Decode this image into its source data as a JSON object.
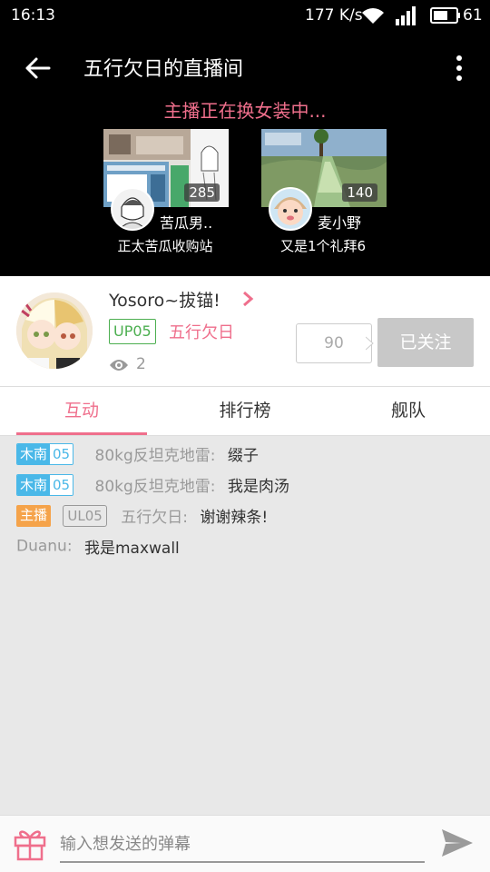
{
  "status_bar": {
    "time": "16:13",
    "net_speed": "177 K/s",
    "battery": "61"
  },
  "header": {
    "title": "五行欠日的直播间",
    "banner": "主播正在换女装中..."
  },
  "recommendations": [
    {
      "count": "285",
      "name": "苦瓜男..",
      "room": "正太苦瓜收购站"
    },
    {
      "count": "140",
      "name": "麦小野",
      "room": "又是1个礼拜6"
    }
  ],
  "profile": {
    "stream_title": "Yosoro~拔锚!",
    "level": "UP05",
    "name": "五行欠日",
    "viewers": "2",
    "fans": "90",
    "follow_label": "已关注"
  },
  "tabs": [
    "互动",
    "排行榜",
    "舰队"
  ],
  "chat": [
    {
      "badge_type": "fan",
      "badge_name": "木南",
      "badge_level": "05",
      "sender": "80kg反坦克地雷:",
      "message": "缀子"
    },
    {
      "badge_type": "fan",
      "badge_name": "木南",
      "badge_level": "05",
      "sender": "80kg反坦克地雷:",
      "message": "我是肉汤"
    },
    {
      "badge_type": "host",
      "badge_name": "主播",
      "user_level": "UL05",
      "sender": "五行欠日:",
      "message": "谢谢辣条!"
    },
    {
      "badge_type": "none",
      "sender": "Duanu:",
      "message": "我是maxwall"
    }
  ],
  "input": {
    "placeholder": "输入想发送的弹幕"
  },
  "colors": {
    "accent": "#ef6f8c",
    "fan_badge": "#4ab8e8",
    "host_badge": "#f5a34a",
    "level_green": "#4caf50"
  }
}
